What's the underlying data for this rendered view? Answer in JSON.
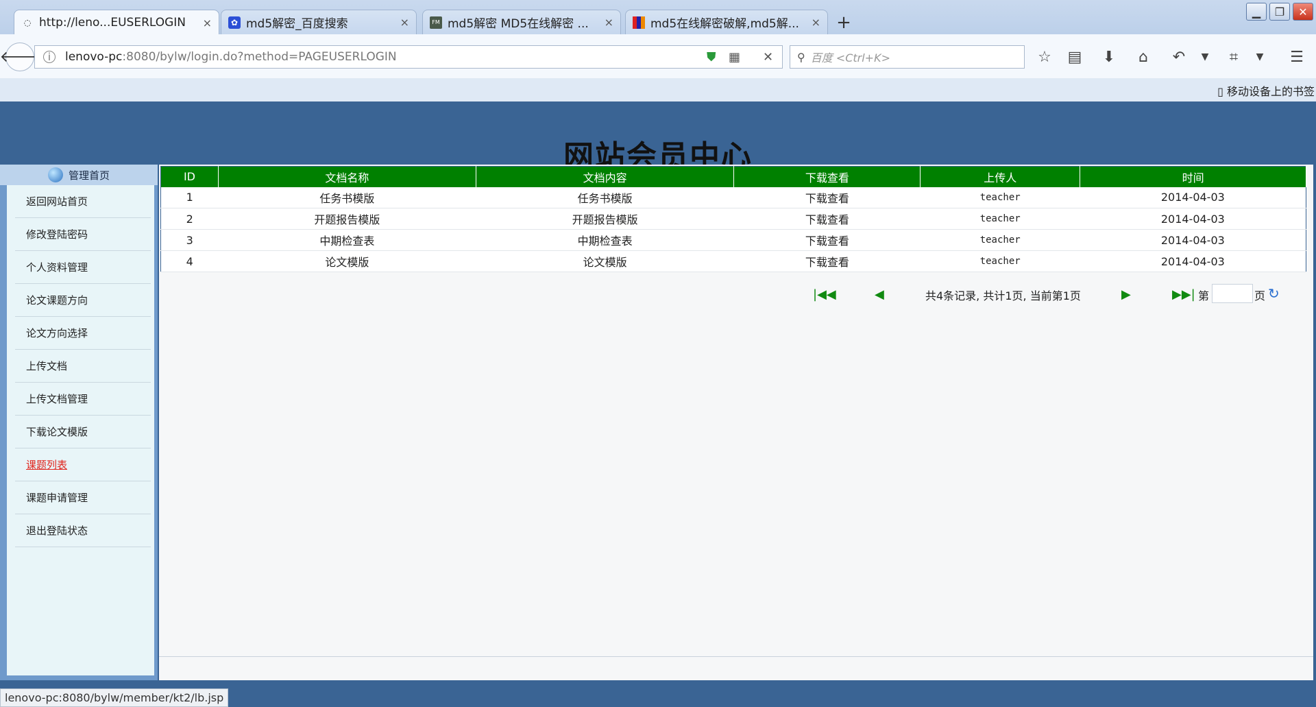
{
  "browser": {
    "tabs": [
      {
        "title": "http://leno...EUSERLOGIN",
        "favicon": "globe-icon"
      },
      {
        "title": "md5解密_百度搜索",
        "favicon": "baidu-paw-icon"
      },
      {
        "title": "md5解密 MD5在线解密 ...",
        "favicon": "fmds-icon"
      },
      {
        "title": "md5在线解密破解,md5解...",
        "favicon": "grid-icon"
      }
    ],
    "close_glyph": "×",
    "new_tab_glyph": "+",
    "url_host": "lenovo-pc",
    "url_rest": ":8080/bylw/login.do?method=PAGEUSERLOGIN",
    "search_placeholder": "百度 <Ctrl+K>",
    "mobile_bookmarks": "移动设备上的书签"
  },
  "site": {
    "title": "网站会员中心"
  },
  "sidebar": {
    "header": "管理首页",
    "items": [
      {
        "label": "返回网站首页"
      },
      {
        "label": "修改登陆密码"
      },
      {
        "label": "个人资料管理"
      },
      {
        "label": "论文课题方向"
      },
      {
        "label": "论文方向选择"
      },
      {
        "label": "上传文档"
      },
      {
        "label": "上传文档管理"
      },
      {
        "label": "下载论文模版"
      },
      {
        "label": "课题列表"
      },
      {
        "label": "课题申请管理"
      },
      {
        "label": "退出登陆状态"
      }
    ]
  },
  "table": {
    "headers": [
      "ID",
      "文档名称",
      "文档内容",
      "下载查看",
      "上传人",
      "时间"
    ],
    "rows": [
      [
        "1",
        "任务书模版",
        "任务书模版",
        "下载查看",
        "teacher",
        "2014-04-03"
      ],
      [
        "2",
        "开题报告模版",
        "开题报告模版",
        "下载查看",
        "teacher",
        "2014-04-03"
      ],
      [
        "3",
        "中期检查表",
        "中期检查表",
        "下载查看",
        "teacher",
        "2014-04-03"
      ],
      [
        "4",
        "论文模版",
        "论文模版",
        "下载查看",
        "teacher",
        "2014-04-03"
      ]
    ]
  },
  "pager": {
    "first": "|◀◀",
    "prev": "◀",
    "info": "共4条记录, 共计1页, 当前第1页",
    "next": "▶",
    "last": "▶▶|",
    "di": "第",
    "ye": "页",
    "go": "↻"
  },
  "status_bar": "lenovo-pc:8080/bylw/member/kt2/lb.jsp",
  "colors": {
    "page_bg": "#3a6494",
    "table_header": "#008000",
    "sidebar_menu_bg": "#e8f5f8",
    "hot_link": "#e0261e"
  }
}
